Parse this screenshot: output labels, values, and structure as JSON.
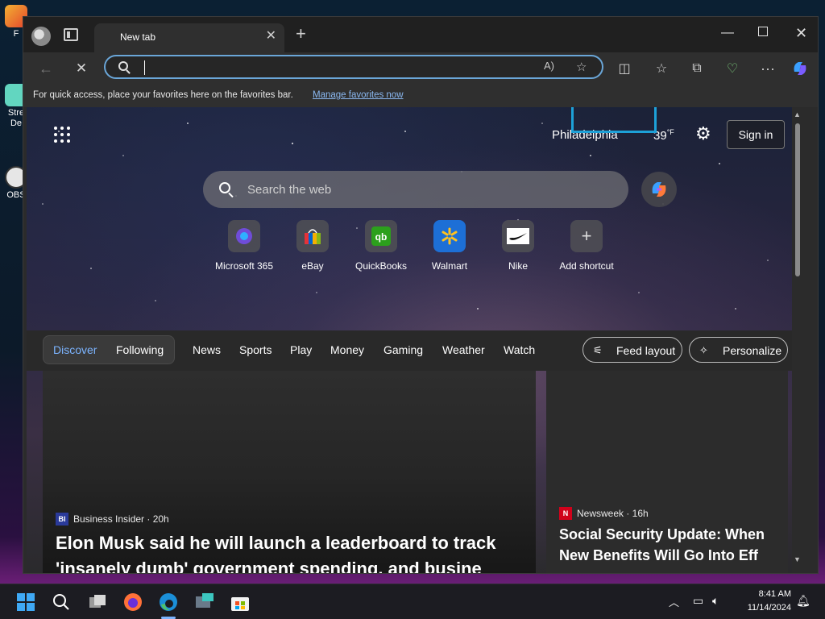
{
  "desktop": {
    "icons": [
      {
        "label": "F"
      },
      {
        "label": "Stre\nDe"
      },
      {
        "label": "OBS"
      }
    ]
  },
  "browser": {
    "tab": {
      "title": "New tab"
    },
    "address": {
      "value": ""
    },
    "favbar": {
      "message": "For quick access, place your favorites here on the favorites bar.",
      "link": "Manage favorites now"
    }
  },
  "newtab": {
    "location": "Philadelphia",
    "temperature": "39",
    "temperature_unit": "°F",
    "sign_in": "Sign in",
    "search_placeholder": "Search the web",
    "shortcuts": [
      {
        "label": "Microsoft 365",
        "icon": "microsoft-365-icon"
      },
      {
        "label": "eBay",
        "icon": "ebay-icon"
      },
      {
        "label": "QuickBooks",
        "icon": "quickbooks-icon"
      },
      {
        "label": "Walmart",
        "icon": "walmart-icon"
      },
      {
        "label": "Nike",
        "icon": "nike-icon"
      },
      {
        "label": "Add shortcut",
        "icon": "plus-icon"
      }
    ],
    "feed_tabs": {
      "discover": "Discover",
      "following": "Following",
      "news": "News",
      "sports": "Sports",
      "play": "Play",
      "money": "Money",
      "gaming": "Gaming",
      "weather": "Weather",
      "watch": "Watch"
    },
    "feed_layout": "Feed layout",
    "personalize": "Personalize",
    "cards": [
      {
        "source_logo": "BI",
        "source": "Business Insider · 20h",
        "headline": "Elon Musk said he will launch a leaderboard to track 'insanely dumb' government spending, and busine"
      },
      {
        "source_logo": "N",
        "source": "Newsweek · 16h",
        "headline": "Social Security Update: When New Benefits Will Go Into Eff"
      }
    ]
  },
  "taskbar": {
    "time": "8:41 AM",
    "date": "11/14/2024"
  },
  "colors": {
    "accent": "#7cb4ff",
    "address_focus": "#6aa6d8",
    "highlight_box": "#1da1d8"
  }
}
